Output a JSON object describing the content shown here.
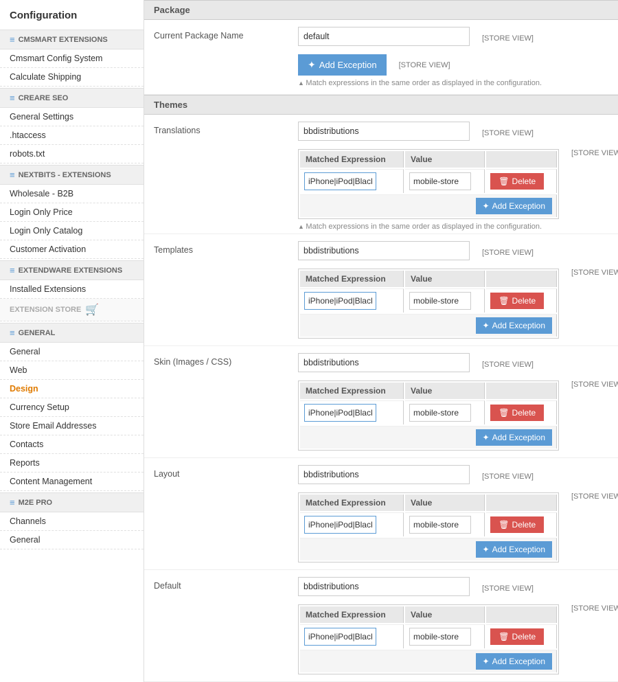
{
  "sidebar": {
    "title": "Configuration",
    "sections": [
      {
        "id": "cmsmart",
        "label": "CMSMART EXTENSIONS",
        "items": [
          {
            "id": "cmsmart-config",
            "label": "Cmsmart Config System",
            "active": false
          },
          {
            "id": "calculate-shipping",
            "label": "Calculate Shipping",
            "active": false
          }
        ]
      },
      {
        "id": "creare-seo",
        "label": "CREARE SEO",
        "items": [
          {
            "id": "general-settings",
            "label": "General Settings",
            "active": false
          },
          {
            "id": "htaccess",
            "label": ".htaccess",
            "active": false
          },
          {
            "id": "robots-txt",
            "label": "robots.txt",
            "active": false
          }
        ]
      },
      {
        "id": "nextbits",
        "label": "NEXTBITS - EXTENSIONS",
        "items": [
          {
            "id": "wholesale-b2b",
            "label": "Wholesale - B2B",
            "active": false
          },
          {
            "id": "login-only-price",
            "label": "Login Only Price",
            "active": false
          },
          {
            "id": "login-only-catalog",
            "label": "Login Only Catalog",
            "active": false
          },
          {
            "id": "customer-activation",
            "label": "Customer Activation",
            "active": false
          }
        ]
      },
      {
        "id": "extendware",
        "label": "EXTENDWARE EXTENSIONS",
        "items": [
          {
            "id": "installed-extensions",
            "label": "Installed Extensions",
            "active": false
          },
          {
            "id": "extension-store",
            "label": "EXTENSION STORE",
            "active": false,
            "special": true
          }
        ]
      },
      {
        "id": "general",
        "label": "GENERAL",
        "items": [
          {
            "id": "general",
            "label": "General",
            "active": false
          },
          {
            "id": "web",
            "label": "Web",
            "active": false
          },
          {
            "id": "design",
            "label": "Design",
            "active": true
          },
          {
            "id": "currency-setup",
            "label": "Currency Setup",
            "active": false
          },
          {
            "id": "store-email",
            "label": "Store Email Addresses",
            "active": false
          },
          {
            "id": "contacts",
            "label": "Contacts",
            "active": false
          },
          {
            "id": "reports",
            "label": "Reports",
            "active": false
          },
          {
            "id": "content-management",
            "label": "Content Management",
            "active": false
          }
        ]
      },
      {
        "id": "m2e-pro",
        "label": "M2E PRO",
        "items": [
          {
            "id": "channels",
            "label": "Channels",
            "active": false
          },
          {
            "id": "general-m2e",
            "label": "General",
            "active": false
          }
        ]
      }
    ]
  },
  "main": {
    "package_section": "Package",
    "themes_section": "Themes",
    "package": {
      "label": "Current Package Name",
      "value": "default",
      "store_view": "[STORE VIEW]",
      "add_exception_label": "Add Exception",
      "add_exception_store_view": "[STORE VIEW]",
      "note": "Match expressions in the same order as displayed in the configuration."
    },
    "translations": {
      "label": "Translations",
      "value": "bbdistributions",
      "store_view": "[STORE VIEW]",
      "exception_store_view": "[STORE VIEW]",
      "matched_expression_header": "Matched Expression",
      "value_header": "Value",
      "expr_value": "iPhone|iPod|BlackB",
      "cell_value": "mobile-store",
      "delete_label": "Delete",
      "add_exception_label": "Add Exception"
    },
    "templates": {
      "label": "Templates",
      "value": "bbdistributions",
      "store_view": "[STORE VIEW]",
      "exception_store_view": "[STORE VIEW]",
      "matched_expression_header": "Matched Expression",
      "value_header": "Value",
      "expr_value": "iPhone|iPod|BlackE",
      "cell_value": "mobile-store",
      "delete_label": "Delete",
      "add_exception_label": "Add Exception"
    },
    "skin": {
      "label": "Skin (Images / CSS)",
      "value": "bbdistributions",
      "store_view": "[STORE VIEW]",
      "exception_store_view": "[STORE VIEW]",
      "matched_expression_header": "Matched Expression",
      "value_header": "Value",
      "expr_value": "iPhone|iPod|BlackE",
      "cell_value": "mobile-store",
      "delete_label": "Delete",
      "add_exception_label": "Add Exception"
    },
    "layout": {
      "label": "Layout",
      "value": "bbdistributions",
      "store_view": "[STORE VIEW]",
      "exception_store_view": "[STORE VIEW]",
      "matched_expression_header": "Matched Expression",
      "value_header": "Value",
      "expr_value": "iPhone|iPod|BlackE",
      "cell_value": "mobile-store",
      "delete_label": "Delete",
      "add_exception_label": "Add Exception"
    },
    "default": {
      "label": "Default",
      "value": "bbdistributions",
      "store_view": "[STORE VIEW]",
      "exception_store_view": "[STORE VIEW]",
      "matched_expression_header": "Matched Expression",
      "value_header": "Value",
      "expr_value": "iPhone|iPod|BlackE",
      "cell_value": "mobile-store",
      "delete_label": "Delete",
      "add_exception_label": "Add Exception"
    }
  }
}
